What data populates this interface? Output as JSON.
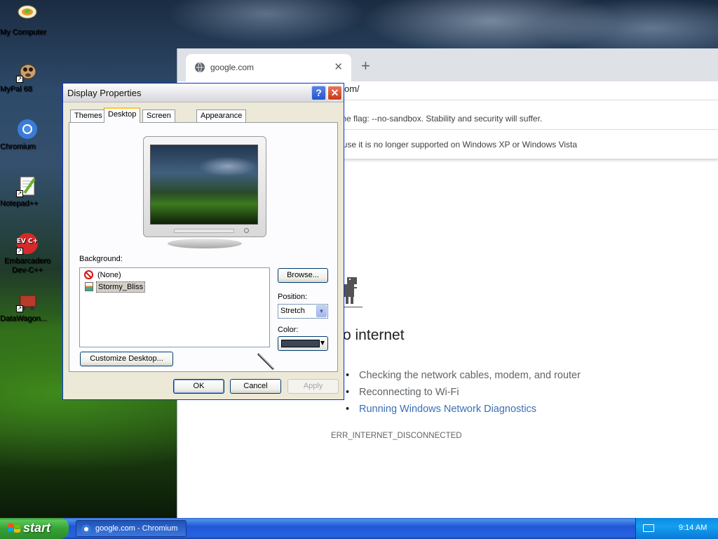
{
  "desktop": {
    "icons": [
      {
        "label": "My Computer",
        "icon": "my-computer-icon"
      },
      {
        "label": "MyPal 68",
        "icon": "mypal-icon"
      },
      {
        "label": "Chromium",
        "icon": "chromium-icon"
      },
      {
        "label": "Notepad++",
        "icon": "notepad-plus-plus-icon"
      },
      {
        "label": "Embarcadero Dev-C++",
        "icon": "dev-cpp-icon",
        "badge": "DEV C++"
      },
      {
        "label": "DataWagon...",
        "icon": "datawagon-icon"
      }
    ]
  },
  "browser": {
    "tab_title": "google.com",
    "url_visible": "om/",
    "infobar_1": "line flag: --no-sandbox. Stability and security will suffer.",
    "infobar_2": "ause it is no longer supported on Windows XP or Windows Vista",
    "error_title": "o internet",
    "suggestions": [
      "Checking the network cables, modem, and router",
      "Reconnecting to Wi-Fi",
      "Running Windows Network Diagnostics"
    ],
    "error_code": "ERR_INTERNET_DISCONNECTED",
    "colors": {
      "link": "#3c6fb5",
      "text": "#5f6368"
    }
  },
  "dialog": {
    "title": "Display Properties",
    "help_glyph": "?",
    "close_glyph": "✕",
    "tabs": [
      "Themes",
      "Desktop",
      "Screen Saver",
      "Appearance"
    ],
    "active_tab": "Desktop",
    "background_label": "Background:",
    "background_items": [
      "(None)",
      "Stormy_Bliss"
    ],
    "selected_background": "Stormy_Bliss",
    "browse_label": "Browse...",
    "position_label": "Position:",
    "position_value": "Stretch",
    "color_label": "Color:",
    "color_value": "#3a4656",
    "customize_label": "Customize Desktop...",
    "ok_label": "OK",
    "cancel_label": "Cancel",
    "apply_label": "Apply"
  },
  "taskbar": {
    "start_label": "start",
    "task_label": "google.com - Chromium",
    "clock": "9:14 AM"
  }
}
